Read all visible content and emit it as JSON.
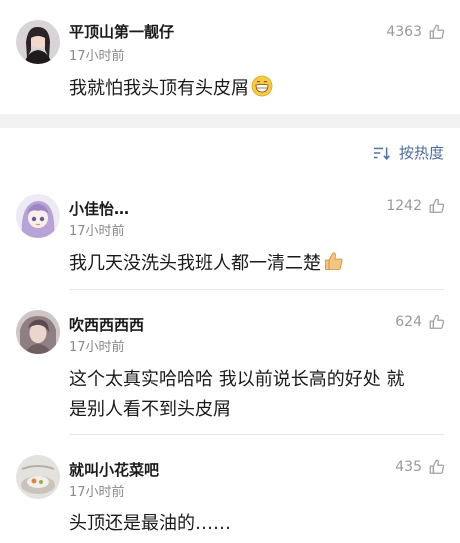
{
  "top_comment": {
    "username": "平顶山第一靓仔",
    "time": "17小时前",
    "likes": "4363",
    "text": "我就怕我头顶有头皮屑"
  },
  "sort": {
    "label": "按热度"
  },
  "comments": [
    {
      "username": "小佳怡…",
      "time": "17小时前",
      "likes": "1242",
      "text": "我几天没洗头我班人都一清二楚"
    },
    {
      "username": "吹西西西西",
      "time": "17小时前",
      "likes": "624",
      "text_line1": "这个太真实哈哈哈 我以前说长高的好处 就",
      "text_line2": "是别人看不到头皮屑"
    },
    {
      "username": "就叫小花菜吧",
      "time": "17小时前",
      "likes": "435",
      "text": "头顶还是最油的……"
    }
  ],
  "icons": {
    "like": "thumbs-up-outline-icon",
    "sort": "sort-lines-icon"
  },
  "colors": {
    "link": "#4e6ea0",
    "muted": "#8a8a8a",
    "band": "#f2f2f2"
  }
}
